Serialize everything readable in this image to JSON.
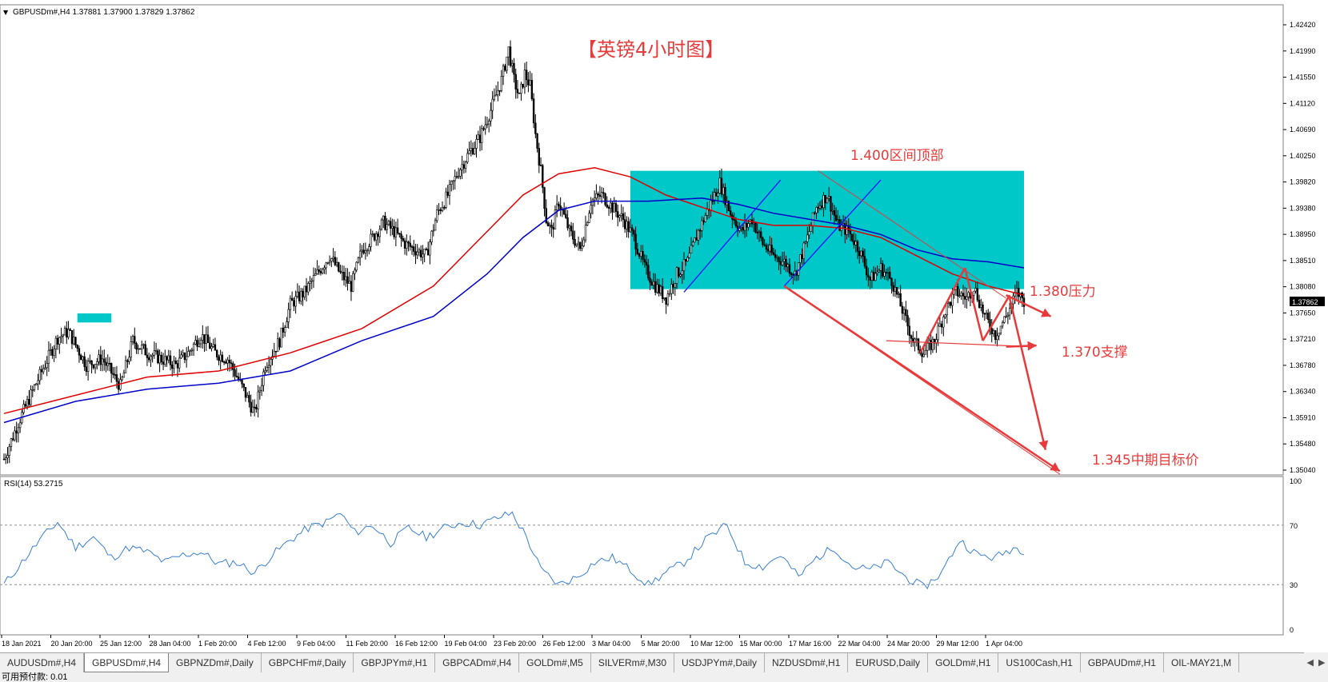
{
  "chart_header": {
    "symbol_info": "GBPUSDm#,H4  1.37881 1.37900 1.37829 1.37862",
    "rsi_info": "RSI(14) 53.2715"
  },
  "annotations": {
    "title": "【英镑4小时图】",
    "top_label": "1.400区间顶部",
    "resistance": "1.380压力",
    "support": "1.370支撑",
    "target": "1.345中期目标价"
  },
  "price_axis": {
    "ticks": [
      "1.42420",
      "1.41990",
      "1.41550",
      "1.41120",
      "1.40690",
      "1.40250",
      "1.39820",
      "1.39380",
      "1.38950",
      "1.38510",
      "1.38080",
      "1.37650",
      "1.37210",
      "1.36780",
      "1.36340",
      "1.35910",
      "1.35480",
      "1.35040"
    ],
    "current_price": "1.37862"
  },
  "rsi_axis": {
    "ticks": [
      "100",
      "70",
      "30",
      "0"
    ]
  },
  "time_axis": {
    "labels": [
      "18 Jan 2021",
      "20 Jan 20:00",
      "25 Jan 12:00",
      "28 Jan 04:00",
      "1 Feb 20:00",
      "4 Feb 12:00",
      "9 Feb 04:00",
      "11 Feb 20:00",
      "16 Feb 12:00",
      "19 Feb 04:00",
      "23 Feb 20:00",
      "26 Feb 12:00",
      "3 Mar 04:00",
      "5 Mar 20:00",
      "10 Mar 12:00",
      "15 Mar 00:00",
      "17 Mar 16:00",
      "22 Mar 04:00",
      "24 Mar 20:00",
      "29 Mar 12:00",
      "1 Apr 04:00"
    ]
  },
  "tabs": [
    {
      "label": "AUDUSDm#,H4",
      "active": false
    },
    {
      "label": "GBPUSDm#,H4",
      "active": true
    },
    {
      "label": "GBPNZDm#,Daily",
      "active": false
    },
    {
      "label": "GBPCHFm#,Daily",
      "active": false
    },
    {
      "label": "GBPJPYm#,H1",
      "active": false
    },
    {
      "label": "GBPCADm#,H4",
      "active": false
    },
    {
      "label": "GOLDm#,M5",
      "active": false
    },
    {
      "label": "SILVERm#,M30",
      "active": false
    },
    {
      "label": "USDJPYm#,Daily",
      "active": false
    },
    {
      "label": "NZDUSDm#,H1",
      "active": false
    },
    {
      "label": "EURUSD,Daily",
      "active": false
    },
    {
      "label": "GOLDm#,H1",
      "active": false
    },
    {
      "label": "US100Cash,H1",
      "active": false
    },
    {
      "label": "GBPAUDm#,H1",
      "active": false
    },
    {
      "label": "OIL-MAY21,M",
      "active": false
    }
  ],
  "status_text": "可用预付款: 0.01",
  "colors": {
    "candles": "#000000",
    "ma_fast": "#e00000",
    "ma_slow": "#0000c8",
    "trend_lines": "#1414ff",
    "zone_fill": "#00c8c8",
    "annotation": "#e83a3a",
    "rsi_line": "#3a7fd0"
  },
  "chart_data": {
    "type": "candlestick",
    "symbol": "GBPUSDm#",
    "timeframe": "H4",
    "ylim": [
      1.3495,
      1.4255
    ],
    "rsi_ylim": [
      0,
      100
    ],
    "rsi_levels": [
      70,
      30
    ],
    "close_path": [
      [
        0,
        1.3525
      ],
      [
        8,
        1.3585
      ],
      [
        18,
        1.365
      ],
      [
        30,
        1.3725
      ],
      [
        36,
        1.3735
      ],
      [
        46,
        1.368
      ],
      [
        55,
        1.369
      ],
      [
        65,
        1.3645
      ],
      [
        72,
        1.372
      ],
      [
        80,
        1.37
      ],
      [
        88,
        1.369
      ],
      [
        96,
        1.368
      ],
      [
        103,
        1.37
      ],
      [
        110,
        1.373
      ],
      [
        118,
        1.37
      ],
      [
        125,
        1.369
      ],
      [
        132,
        1.365
      ],
      [
        140,
        1.36
      ],
      [
        146,
        1.368
      ],
      [
        154,
        1.372
      ],
      [
        160,
        1.378
      ],
      [
        168,
        1.38
      ],
      [
        176,
        1.3835
      ],
      [
        182,
        1.386
      ],
      [
        188,
        1.383
      ],
      [
        194,
        1.381
      ],
      [
        200,
        1.387
      ],
      [
        206,
        1.389
      ],
      [
        212,
        1.3915
      ],
      [
        218,
        1.39
      ],
      [
        224,
        1.388
      ],
      [
        230,
        1.387
      ],
      [
        236,
        1.386
      ],
      [
        242,
        1.393
      ],
      [
        248,
        1.396
      ],
      [
        254,
        1.4
      ],
      [
        260,
        1.403
      ],
      [
        266,
        1.4055
      ],
      [
        272,
        1.41
      ],
      [
        278,
        1.415
      ],
      [
        282,
        1.42
      ],
      [
        285,
        1.415
      ],
      [
        288,
        1.412
      ],
      [
        291,
        1.416
      ],
      [
        294,
        1.414
      ],
      [
        297,
        1.406
      ],
      [
        300,
        1.4
      ],
      [
        303,
        1.392
      ],
      [
        306,
        1.39
      ],
      [
        310,
        1.395
      ],
      [
        316,
        1.39
      ],
      [
        322,
        1.387
      ],
      [
        328,
        1.395
      ],
      [
        334,
        1.396
      ],
      [
        340,
        1.394
      ],
      [
        346,
        1.392
      ],
      [
        352,
        1.389
      ],
      [
        358,
        1.384
      ],
      [
        364,
        1.381
      ],
      [
        370,
        1.379
      ],
      [
        376,
        1.383
      ],
      [
        382,
        1.385
      ],
      [
        388,
        1.39
      ],
      [
        394,
        1.394
      ],
      [
        400,
        1.398
      ],
      [
        406,
        1.393
      ],
      [
        412,
        1.39
      ],
      [
        418,
        1.392
      ],
      [
        424,
        1.388
      ],
      [
        430,
        1.386
      ],
      [
        436,
        1.385
      ],
      [
        442,
        1.383
      ],
      [
        448,
        1.388
      ],
      [
        454,
        1.394
      ],
      [
        460,
        1.396
      ],
      [
        466,
        1.391
      ],
      [
        472,
        1.39
      ],
      [
        478,
        1.387
      ],
      [
        484,
        1.382
      ],
      [
        490,
        1.384
      ],
      [
        496,
        1.382
      ],
      [
        502,
        1.377
      ],
      [
        508,
        1.372
      ],
      [
        514,
        1.37
      ],
      [
        520,
        1.372
      ],
      [
        526,
        1.377
      ],
      [
        532,
        1.38
      ],
      [
        538,
        1.379
      ],
      [
        542,
        1.381
      ],
      [
        548,
        1.376
      ],
      [
        554,
        1.373
      ],
      [
        560,
        1.376
      ],
      [
        566,
        1.38
      ],
      [
        570,
        1.3786
      ]
    ],
    "ma_fast_path": [
      [
        0,
        1.36
      ],
      [
        40,
        1.363
      ],
      [
        80,
        1.366
      ],
      [
        120,
        1.367
      ],
      [
        160,
        1.37
      ],
      [
        200,
        1.374
      ],
      [
        240,
        1.381
      ],
      [
        270,
        1.39
      ],
      [
        290,
        1.396
      ],
      [
        310,
        1.3995
      ],
      [
        330,
        1.4005
      ],
      [
        350,
        1.399
      ],
      [
        370,
        1.396
      ],
      [
        390,
        1.394
      ],
      [
        410,
        1.392
      ],
      [
        430,
        1.391
      ],
      [
        450,
        1.391
      ],
      [
        470,
        1.3905
      ],
      [
        490,
        1.389
      ],
      [
        510,
        1.386
      ],
      [
        530,
        1.383
      ],
      [
        550,
        1.381
      ],
      [
        570,
        1.3795
      ]
    ],
    "ma_slow_path": [
      [
        0,
        1.3585
      ],
      [
        40,
        1.362
      ],
      [
        80,
        1.364
      ],
      [
        120,
        1.365
      ],
      [
        160,
        1.367
      ],
      [
        200,
        1.372
      ],
      [
        240,
        1.376
      ],
      [
        270,
        1.383
      ],
      [
        290,
        1.389
      ],
      [
        310,
        1.3935
      ],
      [
        330,
        1.395
      ],
      [
        360,
        1.395
      ],
      [
        390,
        1.3955
      ],
      [
        410,
        1.3945
      ],
      [
        430,
        1.393
      ],
      [
        450,
        1.392
      ],
      [
        470,
        1.391
      ],
      [
        490,
        1.3895
      ],
      [
        510,
        1.387
      ],
      [
        530,
        1.3855
      ],
      [
        550,
        1.385
      ],
      [
        570,
        1.384
      ]
    ],
    "rsi_path": [
      [
        0,
        30
      ],
      [
        10,
        45
      ],
      [
        20,
        60
      ],
      [
        30,
        72
      ],
      [
        40,
        55
      ],
      [
        50,
        62
      ],
      [
        60,
        48
      ],
      [
        70,
        55
      ],
      [
        80,
        52
      ],
      [
        90,
        45
      ],
      [
        100,
        50
      ],
      [
        110,
        52
      ],
      [
        120,
        44
      ],
      [
        130,
        45
      ],
      [
        140,
        38
      ],
      [
        150,
        50
      ],
      [
        160,
        60
      ],
      [
        170,
        68
      ],
      [
        180,
        72
      ],
      [
        188,
        78
      ],
      [
        196,
        65
      ],
      [
        206,
        70
      ],
      [
        216,
        58
      ],
      [
        226,
        68
      ],
      [
        236,
        62
      ],
      [
        246,
        68
      ],
      [
        256,
        72
      ],
      [
        266,
        70
      ],
      [
        276,
        75
      ],
      [
        284,
        78
      ],
      [
        292,
        62
      ],
      [
        300,
        40
      ],
      [
        310,
        30
      ],
      [
        320,
        35
      ],
      [
        330,
        45
      ],
      [
        340,
        48
      ],
      [
        350,
        40
      ],
      [
        360,
        30
      ],
      [
        370,
        38
      ],
      [
        380,
        45
      ],
      [
        392,
        60
      ],
      [
        404,
        70
      ],
      [
        414,
        45
      ],
      [
        424,
        42
      ],
      [
        434,
        50
      ],
      [
        444,
        35
      ],
      [
        454,
        48
      ],
      [
        464,
        55
      ],
      [
        474,
        42
      ],
      [
        484,
        40
      ],
      [
        494,
        45
      ],
      [
        504,
        35
      ],
      [
        514,
        28
      ],
      [
        524,
        38
      ],
      [
        534,
        60
      ],
      [
        544,
        50
      ],
      [
        554,
        48
      ],
      [
        564,
        55
      ],
      [
        570,
        53
      ]
    ],
    "zones": [
      {
        "from": [
          20,
          1.3765
        ],
        "to": [
          60,
          1.375
        ]
      },
      {
        "from": [
          350,
          1.4
        ],
        "to": [
          570,
          1.3805
        ]
      }
    ],
    "levels": {
      "zone_top": 1.4,
      "resistance": 1.38,
      "support": 1.37,
      "target": 1.345
    }
  }
}
